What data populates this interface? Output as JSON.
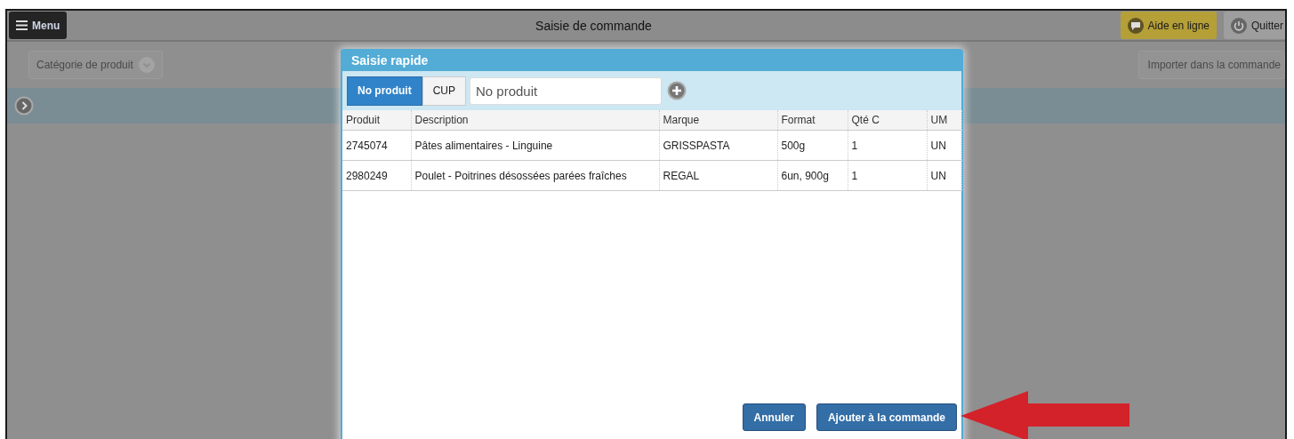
{
  "topbar": {
    "menu_button": "Menu",
    "title": "Saisie de commande",
    "help_button": "Aide en ligne",
    "quit_button": "Quitter"
  },
  "toolbar": {
    "category_button": "Catégorie de produit",
    "import_button": "Importer dans la commande"
  },
  "dialog": {
    "title": "Saisie rapide",
    "search_modes": [
      {
        "label": "No produit",
        "selected": true
      },
      {
        "label": "CUP",
        "selected": false
      }
    ],
    "search": {
      "placeholder": "No produit"
    },
    "table": {
      "columns": [
        "Produit",
        "Description",
        "Marque",
        "Format",
        "Qté C",
        "UM"
      ],
      "rows": [
        [
          "2745074",
          "Pâtes alimentaires - Linguine",
          "GRISSPASTA",
          "500g",
          "1",
          "UN"
        ],
        [
          "2980249",
          "Poulet - Poitrines désossées parées fraîches",
          "REGAL",
          "6un, 900g",
          "1",
          "UN"
        ]
      ]
    },
    "buttons": [
      {
        "label": "Annuler"
      },
      {
        "label": "Ajouter à la commande"
      }
    ]
  }
}
